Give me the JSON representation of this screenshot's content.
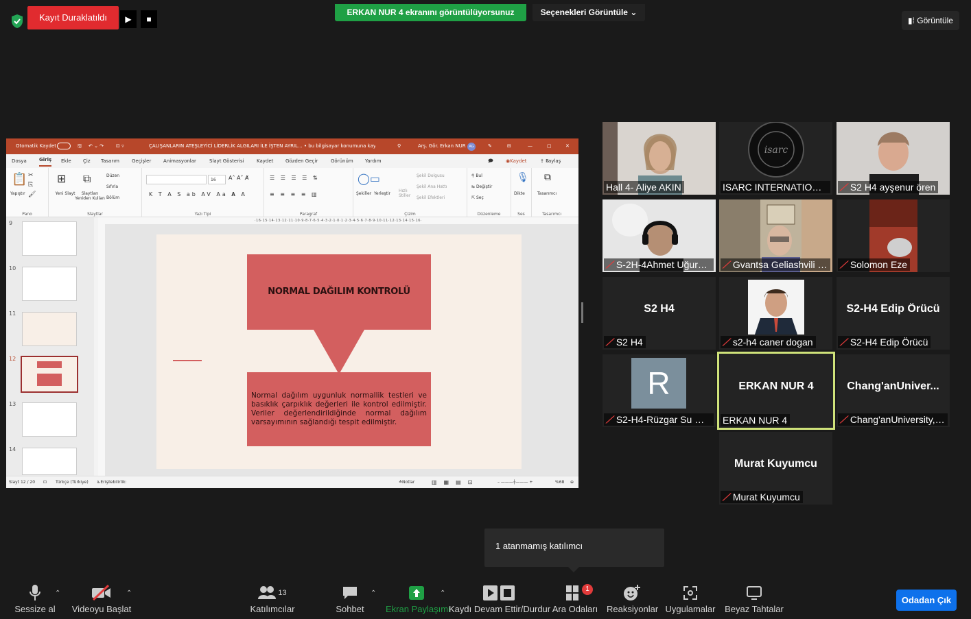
{
  "top_bar": {
    "recording_status": "Kayıt Duraklatıldı",
    "share_banner": "ERKAN NUR 4 ekranını görüntülüyorsunuz",
    "view_options": "Seçenekleri Görüntüle",
    "view_button": "Görüntüle"
  },
  "ppt": {
    "autosave": "Otomatik Kaydet",
    "doc_title": "ÇALIŞANLARIN ATEŞLEYİCİ LİDERLİK ALGILARI İLE İŞTEN AYRIL... • bu bilgisayar konumuna kaydedildi",
    "user": "Arş. Gör. Erkan NUR",
    "user_initials": "AG",
    "tabs": [
      "Dosya",
      "Giriş",
      "Ekle",
      "Çiz",
      "Tasarım",
      "Geçişler",
      "Animasyonlar",
      "Slayt Gösterisi",
      "Kaydet",
      "Gözden Geçir",
      "Görünüm",
      "Yardım"
    ],
    "record_btn": "Kaydet",
    "share_btn": "Paylaş",
    "ribbon_groups": [
      "Pano",
      "Slaytlar",
      "Yazı Tipi",
      "Paragraf",
      "Çizim",
      "Düzenleme",
      "Ses",
      "Tasarımcı"
    ],
    "ribbon_items": {
      "paste": "Yapıştır",
      "new_slide": "Yeni Slayt",
      "reuse": "Slaytları Yeniden Kullan",
      "layout": "Düzen",
      "reset": "Sıfırla",
      "section": "Bölüm",
      "font_size": "16",
      "shapes": "Şekiller",
      "arrange": "Yerleştir",
      "quick_styles": "Hızlı Stiller",
      "fill": "Şekil Dolgusu",
      "outline": "Şekil Ana Hattı",
      "effects": "Şekil Efektleri",
      "find": "Bul",
      "replace": "Değiştir",
      "select": "Seç",
      "dictate": "Dikte",
      "designer": "Tasarımcı"
    },
    "thumb_numbers": [
      "9",
      "10",
      "11",
      "12",
      "13",
      "14"
    ],
    "slide": {
      "heading": "NORMAL DAĞILIM KONTROLÜ",
      "body": "Normal dağılım uygunluk normallik testleri ve basıklık çarpıklık değerleri ile kontrol edilmiştir. Veriler değerlendirildiğinde normal dağılım varsayımının sağlandığı tespit edilmiştir."
    },
    "status": {
      "slide": "Slayt 12 / 20",
      "language": "Türkçe (Türkiye)",
      "accessibility": "Erişilebilirlik: Önerilere göz atın",
      "notes": "Notlar",
      "zoom": "%68"
    }
  },
  "participants": [
    {
      "name": "Hall 4- Aliye AKIN",
      "muted": false
    },
    {
      "name": "ISARC INTERNATIONAL ...",
      "muted": false
    },
    {
      "name": "S2 H4 ayşenur ören",
      "muted": true
    },
    {
      "name": "S-2H-4Ahmet Uğurka...",
      "muted": true
    },
    {
      "name": "Gvantsa Geliashvili Ph...",
      "muted": true
    },
    {
      "name": "Solomon Eze",
      "muted": true
    },
    {
      "name": "S2 H4",
      "center": "S2 H4",
      "muted": true
    },
    {
      "name": "s2-h4 caner dogan",
      "muted": true
    },
    {
      "name": "S2-H4 Edip Örücü",
      "center": "S2-H4 Edip Örücü",
      "muted": true
    },
    {
      "name": "S2-H4-Rüzgar Su Gür...",
      "avatar": "R",
      "muted": true
    },
    {
      "name": "ERKAN NUR 4",
      "center": "ERKAN NUR 4",
      "muted": false
    },
    {
      "name": "Chang'anUniversity, Y...",
      "center": "Chang'anUniver...",
      "muted": true
    },
    {
      "name": "Murat Kuyumcu",
      "center": "Murat Kuyumcu",
      "muted": true
    }
  ],
  "tooltip": "1 atanmamış katılımcı",
  "toolbar": {
    "mute": "Sessize al",
    "video": "Videoyu Başlat",
    "participants": "Katılımcılar",
    "participants_count": "13",
    "chat": "Sohbet",
    "share": "Ekran Paylaşımı",
    "record": "Kaydı Devam Ettir/Durdur",
    "breakout": "Ara Odaları",
    "breakout_badge": "1",
    "reactions": "Reaksiyonlar",
    "apps": "Uygulamalar",
    "whiteboard": "Beyaz Tahtalar",
    "leave": "Odadan Çık"
  },
  "colors": {
    "recording": "#e12b2f",
    "share_banner": "#1fa045",
    "ppt_titlebar": "#b7472a",
    "slide_box": "#d35f5f",
    "active_speaker": "#cfe27a",
    "leave": "#0e71eb",
    "share_icon": "#1fa045"
  }
}
